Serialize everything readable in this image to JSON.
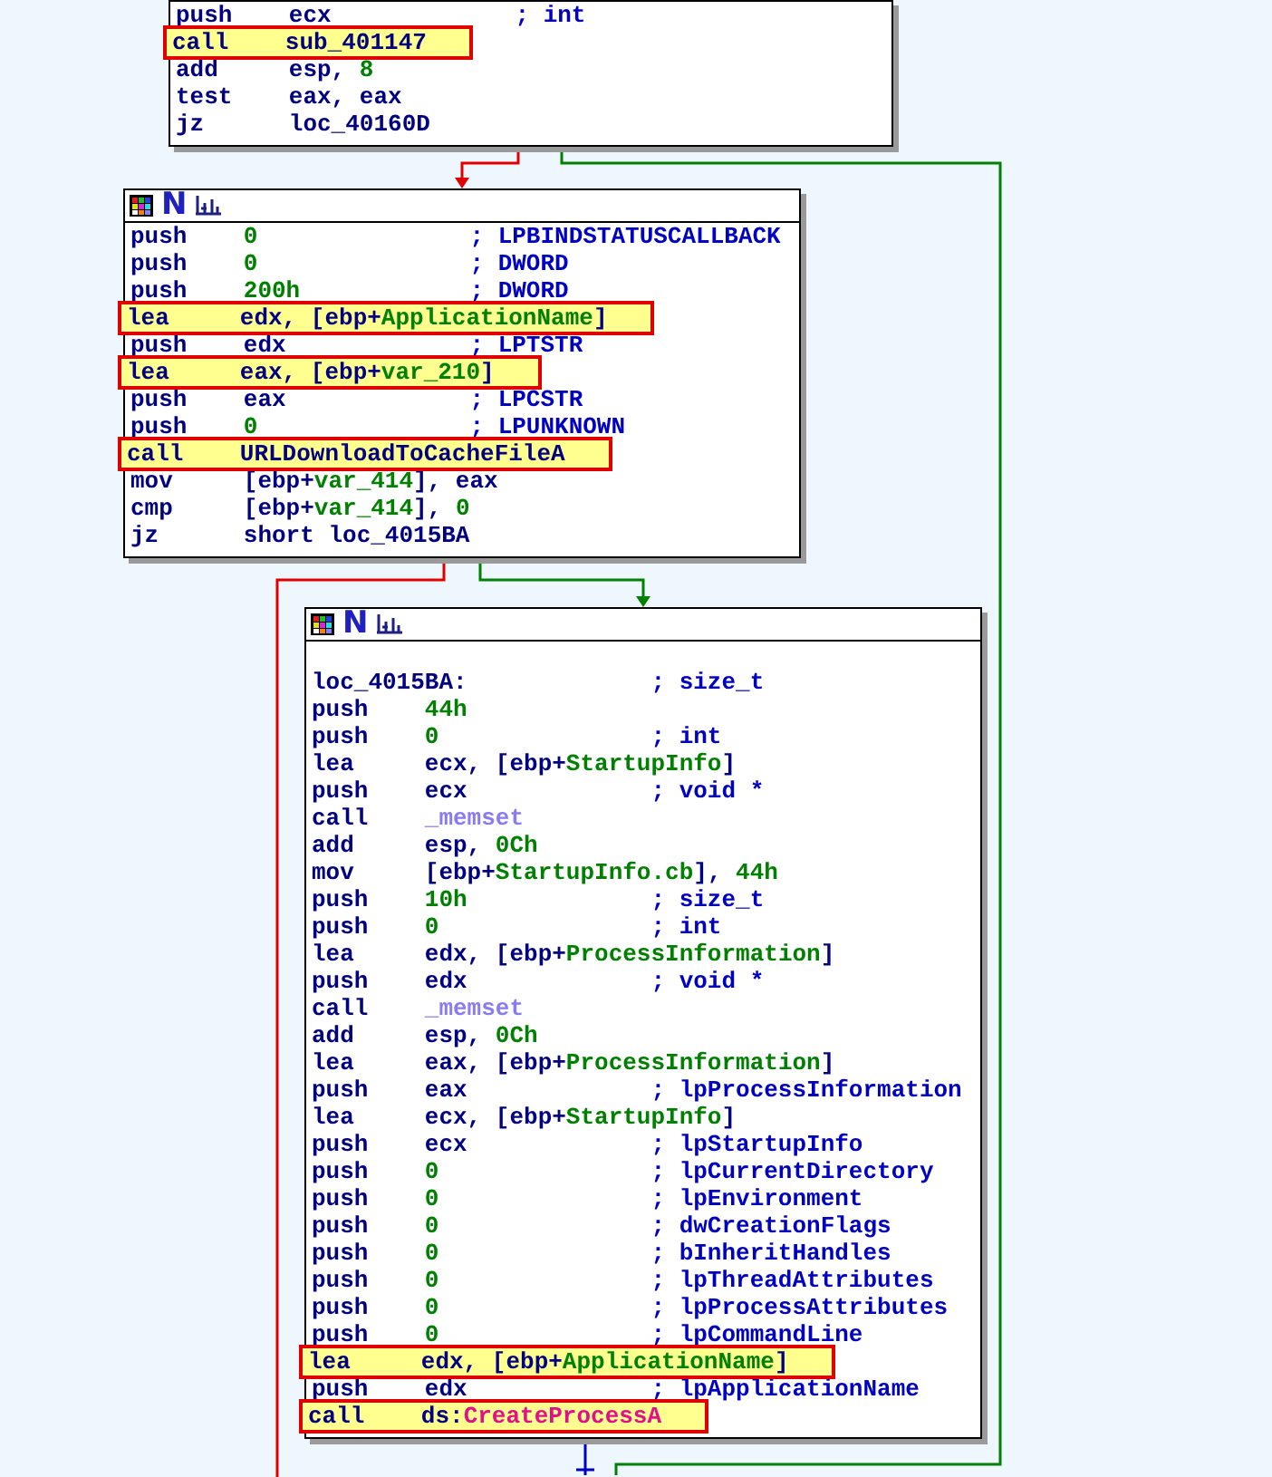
{
  "nodes": [
    {
      "lines": [
        {
          "kind": "instr",
          "op": "push",
          "args": [
            {
              "t": "ecx",
              "kind": "reg"
            }
          ],
          "comment": "; int",
          "highlighted": false
        },
        {
          "kind": "instr",
          "op": "call",
          "args": [
            {
              "t": "sub_401147",
              "kind": "reg"
            }
          ],
          "highlighted": true
        },
        {
          "kind": "instr",
          "op": "add",
          "args": [
            {
              "t": "esp, ",
              "kind": "reg"
            },
            {
              "t": "8",
              "kind": "num"
            }
          ],
          "highlighted": false
        },
        {
          "kind": "instr",
          "op": "test",
          "args": [
            {
              "t": "eax, eax",
              "kind": "reg"
            }
          ],
          "highlighted": false
        },
        {
          "kind": "instr",
          "op": "jz",
          "args": [
            {
              "t": "loc_40160D",
              "kind": "reg"
            }
          ],
          "highlighted": false
        }
      ]
    },
    {
      "header": {
        "mark": "N"
      },
      "lines": [
        {
          "kind": "instr",
          "op": "push",
          "args": [
            {
              "t": "0",
              "kind": "num"
            }
          ],
          "comment": "; LPBINDSTATUSCALLBACK",
          "highlighted": false
        },
        {
          "kind": "instr",
          "op": "push",
          "args": [
            {
              "t": "0",
              "kind": "num"
            }
          ],
          "comment": "; DWORD",
          "highlighted": false
        },
        {
          "kind": "instr",
          "op": "push",
          "args": [
            {
              "t": "200h",
              "kind": "num"
            }
          ],
          "comment": "; DWORD",
          "highlighted": false
        },
        {
          "kind": "instr",
          "op": "lea",
          "args": [
            {
              "t": "edx, [ebp+",
              "kind": "reg"
            },
            {
              "t": "ApplicationName",
              "kind": "name"
            },
            {
              "t": "]",
              "kind": "reg"
            }
          ],
          "highlighted": true
        },
        {
          "kind": "instr",
          "op": "push",
          "args": [
            {
              "t": "edx",
              "kind": "reg"
            }
          ],
          "comment": "; LPTSTR",
          "highlighted": false
        },
        {
          "kind": "instr",
          "op": "lea",
          "args": [
            {
              "t": "eax, [ebp+",
              "kind": "reg"
            },
            {
              "t": "var_210",
              "kind": "name"
            },
            {
              "t": "]",
              "kind": "reg"
            }
          ],
          "highlighted": true
        },
        {
          "kind": "instr",
          "op": "push",
          "args": [
            {
              "t": "eax",
              "kind": "reg"
            }
          ],
          "comment": "; LPCSTR",
          "highlighted": false
        },
        {
          "kind": "instr",
          "op": "push",
          "args": [
            {
              "t": "0",
              "kind": "num"
            }
          ],
          "comment": "; LPUNKNOWN",
          "highlighted": false
        },
        {
          "kind": "instr",
          "op": "call",
          "args": [
            {
              "t": "URLDownloadToCacheFileA",
              "kind": "reg"
            }
          ],
          "highlighted": true
        },
        {
          "kind": "instr",
          "op": "mov",
          "args": [
            {
              "t": "[ebp+",
              "kind": "reg"
            },
            {
              "t": "var_414",
              "kind": "name"
            },
            {
              "t": "], eax",
              "kind": "reg"
            }
          ],
          "highlighted": false
        },
        {
          "kind": "instr",
          "op": "cmp",
          "args": [
            {
              "t": "[ebp+",
              "kind": "reg"
            },
            {
              "t": "var_414",
              "kind": "name"
            },
            {
              "t": "], ",
              "kind": "reg"
            },
            {
              "t": "0",
              "kind": "num"
            }
          ],
          "highlighted": false
        },
        {
          "kind": "instr",
          "op": "jz",
          "args": [
            {
              "t": "short loc_4015BA",
              "kind": "reg"
            }
          ],
          "highlighted": false
        }
      ]
    },
    {
      "header": {
        "mark": "N"
      },
      "lines": [
        {
          "kind": "blank"
        },
        {
          "kind": "label",
          "label": "loc_4015BA:",
          "comment": "; size_t",
          "highlighted": false
        },
        {
          "kind": "instr",
          "op": "push",
          "args": [
            {
              "t": "44h",
              "kind": "num"
            }
          ],
          "highlighted": false
        },
        {
          "kind": "instr",
          "op": "push",
          "args": [
            {
              "t": "0",
              "kind": "num"
            }
          ],
          "comment": "; int",
          "highlighted": false
        },
        {
          "kind": "instr",
          "op": "lea",
          "args": [
            {
              "t": "ecx, [ebp+",
              "kind": "reg"
            },
            {
              "t": "StartupInfo",
              "kind": "name"
            },
            {
              "t": "]",
              "kind": "reg"
            }
          ],
          "highlighted": false
        },
        {
          "kind": "instr",
          "op": "push",
          "args": [
            {
              "t": "ecx",
              "kind": "reg"
            }
          ],
          "comment": "; void *",
          "highlighted": false
        },
        {
          "kind": "instr",
          "op": "call",
          "args": [
            {
              "t": "_memset",
              "kind": "import"
            }
          ],
          "highlighted": false
        },
        {
          "kind": "instr",
          "op": "add",
          "args": [
            {
              "t": "esp, ",
              "kind": "reg"
            },
            {
              "t": "0Ch",
              "kind": "num"
            }
          ],
          "highlighted": false
        },
        {
          "kind": "instr",
          "op": "mov",
          "args": [
            {
              "t": "[ebp+",
              "kind": "reg"
            },
            {
              "t": "StartupInfo.cb",
              "kind": "name"
            },
            {
              "t": "], ",
              "kind": "reg"
            },
            {
              "t": "44h",
              "kind": "num"
            }
          ],
          "highlighted": false
        },
        {
          "kind": "instr",
          "op": "push",
          "args": [
            {
              "t": "10h",
              "kind": "num"
            }
          ],
          "comment": "; size_t",
          "highlighted": false
        },
        {
          "kind": "instr",
          "op": "push",
          "args": [
            {
              "t": "0",
              "kind": "num"
            }
          ],
          "comment": "; int",
          "highlighted": false
        },
        {
          "kind": "instr",
          "op": "lea",
          "args": [
            {
              "t": "edx, [ebp+",
              "kind": "reg"
            },
            {
              "t": "ProcessInformation",
              "kind": "name"
            },
            {
              "t": "]",
              "kind": "reg"
            }
          ],
          "highlighted": false
        },
        {
          "kind": "instr",
          "op": "push",
          "args": [
            {
              "t": "edx",
              "kind": "reg"
            }
          ],
          "comment": "; void *",
          "highlighted": false
        },
        {
          "kind": "instr",
          "op": "call",
          "args": [
            {
              "t": "_memset",
              "kind": "import"
            }
          ],
          "highlighted": false
        },
        {
          "kind": "instr",
          "op": "add",
          "args": [
            {
              "t": "esp, ",
              "kind": "reg"
            },
            {
              "t": "0Ch",
              "kind": "num"
            }
          ],
          "highlighted": false
        },
        {
          "kind": "instr",
          "op": "lea",
          "args": [
            {
              "t": "eax, [ebp+",
              "kind": "reg"
            },
            {
              "t": "ProcessInformation",
              "kind": "name"
            },
            {
              "t": "]",
              "kind": "reg"
            }
          ],
          "highlighted": false
        },
        {
          "kind": "instr",
          "op": "push",
          "args": [
            {
              "t": "eax",
              "kind": "reg"
            }
          ],
          "comment": "; lpProcessInformation",
          "highlighted": false
        },
        {
          "kind": "instr",
          "op": "lea",
          "args": [
            {
              "t": "ecx, [ebp+",
              "kind": "reg"
            },
            {
              "t": "StartupInfo",
              "kind": "name"
            },
            {
              "t": "]",
              "kind": "reg"
            }
          ],
          "highlighted": false
        },
        {
          "kind": "instr",
          "op": "push",
          "args": [
            {
              "t": "ecx",
              "kind": "reg"
            }
          ],
          "comment": "; lpStartupInfo",
          "highlighted": false
        },
        {
          "kind": "instr",
          "op": "push",
          "args": [
            {
              "t": "0",
              "kind": "num"
            }
          ],
          "comment": "; lpCurrentDirectory",
          "highlighted": false
        },
        {
          "kind": "instr",
          "op": "push",
          "args": [
            {
              "t": "0",
              "kind": "num"
            }
          ],
          "comment": "; lpEnvironment",
          "highlighted": false
        },
        {
          "kind": "instr",
          "op": "push",
          "args": [
            {
              "t": "0",
              "kind": "num"
            }
          ],
          "comment": "; dwCreationFlags",
          "highlighted": false
        },
        {
          "kind": "instr",
          "op": "push",
          "args": [
            {
              "t": "0",
              "kind": "num"
            }
          ],
          "comment": "; bInheritHandles",
          "highlighted": false
        },
        {
          "kind": "instr",
          "op": "push",
          "args": [
            {
              "t": "0",
              "kind": "num"
            }
          ],
          "comment": "; lpThreadAttributes",
          "highlighted": false
        },
        {
          "kind": "instr",
          "op": "push",
          "args": [
            {
              "t": "0",
              "kind": "num"
            }
          ],
          "comment": "; lpProcessAttributes",
          "highlighted": false
        },
        {
          "kind": "instr",
          "op": "push",
          "args": [
            {
              "t": "0",
              "kind": "num"
            }
          ],
          "comment": "; lpCommandLine",
          "highlighted": false
        },
        {
          "kind": "instr",
          "op": "lea",
          "args": [
            {
              "t": "edx, [ebp+",
              "kind": "reg"
            },
            {
              "t": "ApplicationName",
              "kind": "name"
            },
            {
              "t": "]",
              "kind": "reg"
            }
          ],
          "highlighted": true
        },
        {
          "kind": "instr",
          "op": "push",
          "args": [
            {
              "t": "edx",
              "kind": "reg"
            }
          ],
          "comment": "; lpApplicationName",
          "highlighted": false
        },
        {
          "kind": "instr",
          "op": "call",
          "args": [
            {
              "t": "ds:",
              "kind": "reg"
            },
            {
              "t": "CreateProcessA",
              "kind": "api"
            }
          ],
          "highlighted": true
        }
      ]
    }
  ],
  "edges": [
    {
      "color": "#e00000"
    },
    {
      "color": "#008000"
    },
    {
      "color": "#e00000"
    },
    {
      "color": "#008000"
    },
    {
      "color": "#0000c0"
    }
  ]
}
